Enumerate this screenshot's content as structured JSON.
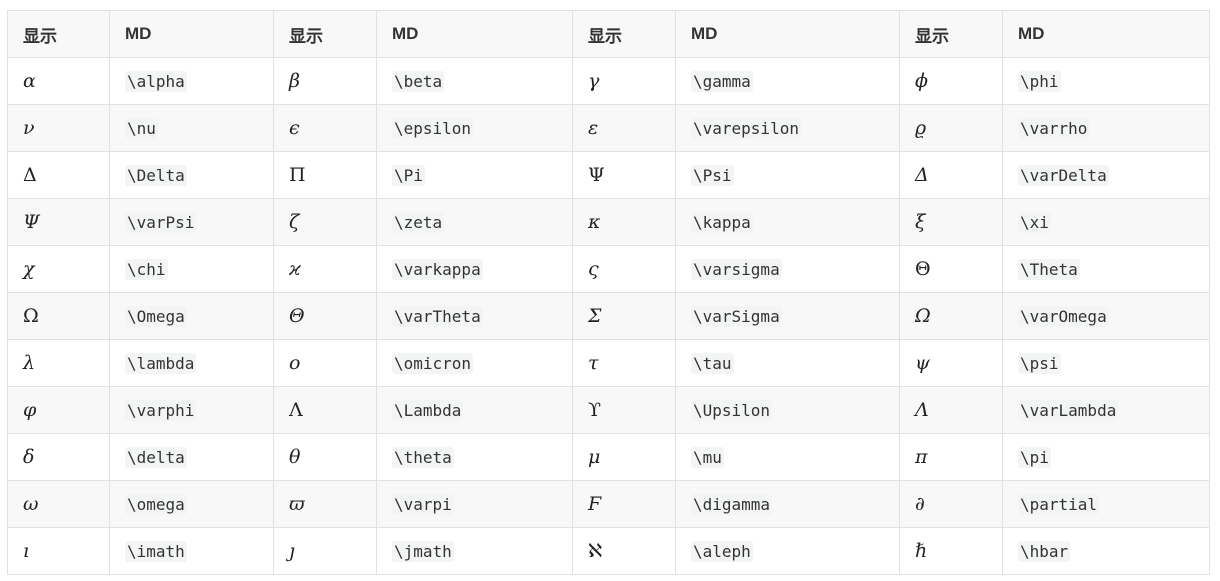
{
  "headers": [
    "显示",
    "MD",
    "显示",
    "MD",
    "显示",
    "MD",
    "显示",
    "MD"
  ],
  "rows": [
    [
      {
        "s": "α",
        "i": 1,
        "m": "\\alpha"
      },
      {
        "s": "β",
        "i": 1,
        "m": "\\beta"
      },
      {
        "s": "γ",
        "i": 1,
        "m": "\\gamma"
      },
      {
        "s": "ϕ",
        "i": 1,
        "m": "\\phi"
      }
    ],
    [
      {
        "s": "ν",
        "i": 1,
        "m": "\\nu"
      },
      {
        "s": "ϵ",
        "i": 1,
        "m": "\\epsilon"
      },
      {
        "s": "ε",
        "i": 1,
        "m": "\\varepsilon"
      },
      {
        "s": "ϱ",
        "i": 1,
        "m": "\\varrho"
      }
    ],
    [
      {
        "s": "Δ",
        "i": 0,
        "m": "\\Delta"
      },
      {
        "s": "Π",
        "i": 0,
        "m": "\\Pi"
      },
      {
        "s": "Ψ",
        "i": 0,
        "m": "\\Psi"
      },
      {
        "s": "Δ",
        "i": 1,
        "m": "\\varDelta"
      }
    ],
    [
      {
        "s": "Ψ",
        "i": 1,
        "m": "\\varPsi"
      },
      {
        "s": "ζ",
        "i": 1,
        "m": "\\zeta"
      },
      {
        "s": "κ",
        "i": 1,
        "m": "\\kappa"
      },
      {
        "s": "ξ",
        "i": 1,
        "m": "\\xi"
      }
    ],
    [
      {
        "s": "χ",
        "i": 1,
        "m": "\\chi"
      },
      {
        "s": "ϰ",
        "i": 1,
        "m": "\\varkappa"
      },
      {
        "s": "ς",
        "i": 1,
        "m": "\\varsigma"
      },
      {
        "s": "Θ",
        "i": 0,
        "m": "\\Theta"
      }
    ],
    [
      {
        "s": "Ω",
        "i": 0,
        "m": "\\Omega"
      },
      {
        "s": "Θ",
        "i": 1,
        "m": "\\varTheta"
      },
      {
        "s": "Σ",
        "i": 1,
        "m": "\\varSigma"
      },
      {
        "s": "Ω",
        "i": 1,
        "m": "\\varOmega"
      }
    ],
    [
      {
        "s": "λ",
        "i": 1,
        "m": "\\lambda"
      },
      {
        "s": "ο",
        "i": 1,
        "m": "\\omicron"
      },
      {
        "s": "τ",
        "i": 1,
        "m": "\\tau"
      },
      {
        "s": "ψ",
        "i": 1,
        "m": "\\psi"
      }
    ],
    [
      {
        "s": "φ",
        "i": 1,
        "m": "\\varphi"
      },
      {
        "s": "Λ",
        "i": 0,
        "m": "\\Lambda"
      },
      {
        "s": "ϒ",
        "i": 0,
        "m": "\\Upsilon"
      },
      {
        "s": "Λ",
        "i": 1,
        "m": "\\varLambda"
      }
    ],
    [
      {
        "s": "δ",
        "i": 1,
        "m": "\\delta"
      },
      {
        "s": "θ",
        "i": 1,
        "m": "\\theta"
      },
      {
        "s": "μ",
        "i": 1,
        "m": "\\mu"
      },
      {
        "s": "π",
        "i": 1,
        "m": "\\pi"
      }
    ],
    [
      {
        "s": "ω",
        "i": 1,
        "m": "\\omega"
      },
      {
        "s": "ϖ",
        "i": 1,
        "m": "\\varpi"
      },
      {
        "s": "Ϝ",
        "i": 1,
        "m": "\\digamma"
      },
      {
        "s": "∂",
        "i": 1,
        "m": "\\partial"
      }
    ],
    [
      {
        "s": "ı",
        "i": 1,
        "m": "\\imath"
      },
      {
        "s": "ȷ",
        "i": 1,
        "m": "\\jmath"
      },
      {
        "s": "ℵ",
        "i": 0,
        "m": "\\aleph"
      },
      {
        "s": "ℏ",
        "i": 0,
        "m": "\\hbar"
      }
    ]
  ]
}
